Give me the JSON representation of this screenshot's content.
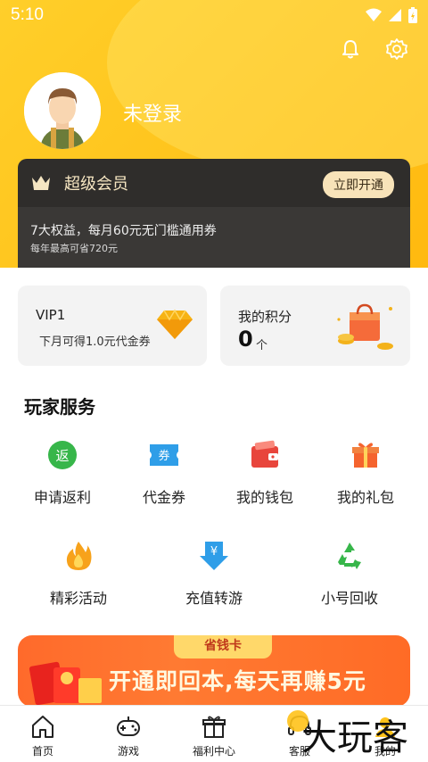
{
  "status": {
    "time": "5:10"
  },
  "profile": {
    "login_text": "未登录"
  },
  "vip": {
    "title": "超级会员",
    "button": "立即开通",
    "description": "7大权益，每月60元无门槛通用券",
    "subtext": "每年最高可省720元"
  },
  "cards": {
    "vip_level": {
      "label": "VIP1",
      "sub": "下月可得1.0元代金券"
    },
    "points": {
      "label": "我的积分",
      "value": "0",
      "unit": "个"
    }
  },
  "services": {
    "title": "玩家服务",
    "items": [
      {
        "label": "申请返利",
        "icon": "rebate-icon"
      },
      {
        "label": "代金券",
        "icon": "voucher-icon"
      },
      {
        "label": "我的钱包",
        "icon": "wallet-icon"
      },
      {
        "label": "我的礼包",
        "icon": "gift-icon"
      },
      {
        "label": "精彩活动",
        "icon": "flame-icon"
      },
      {
        "label": "充值转游",
        "icon": "transfer-icon"
      },
      {
        "label": "小号回收",
        "icon": "recycle-icon"
      }
    ]
  },
  "banner": {
    "tag": "省钱卡",
    "text": "开通即回本,每天再赚5元"
  },
  "tabs": [
    {
      "label": "首页",
      "icon": "home-icon"
    },
    {
      "label": "游戏",
      "icon": "gamepad-icon"
    },
    {
      "label": "福利中心",
      "icon": "gift-icon"
    },
    {
      "label": "客服",
      "icon": "headset-icon"
    },
    {
      "label": "我的",
      "icon": "profile-icon"
    }
  ],
  "watermark": {
    "text": "大玩客"
  },
  "colors": {
    "header": "#ffc21a",
    "vip_card": "#2f2d2b",
    "banner": "#ff6a2b",
    "accent_red": "#e8453c"
  }
}
